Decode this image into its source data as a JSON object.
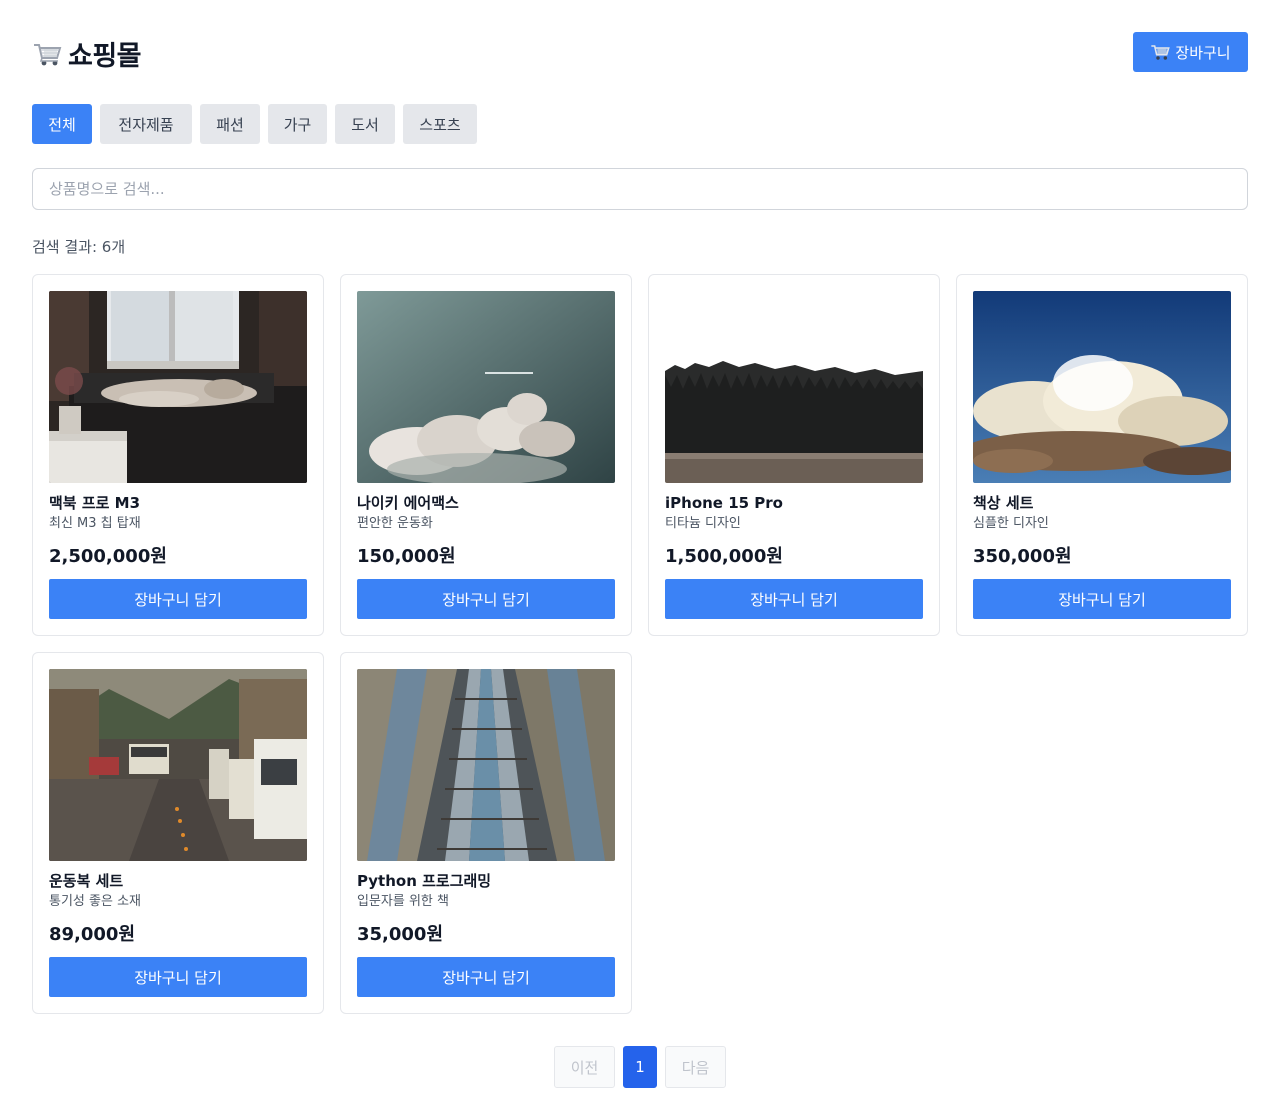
{
  "app": {
    "title": "쇼핑몰",
    "cart_button_label": "장바구니"
  },
  "categories": [
    {
      "label": "전체",
      "active": true
    },
    {
      "label": "전자제품",
      "active": false
    },
    {
      "label": "패션",
      "active": false
    },
    {
      "label": "가구",
      "active": false
    },
    {
      "label": "도서",
      "active": false
    },
    {
      "label": "스포츠",
      "active": false
    }
  ],
  "search": {
    "placeholder": "상품명으로 검색...",
    "value": ""
  },
  "results": {
    "label": "검색 결과: 6개"
  },
  "products": [
    {
      "name": "맥북 프로 M3",
      "description": "최신 M3 칩 탑재",
      "price": "2,500,000원",
      "button": "장바구니 담기",
      "image": "woman-sleeping-by-window-photo"
    },
    {
      "name": "나이키 에어맥스",
      "description": "편안한 운동화",
      "price": "150,000원",
      "button": "장바구니 담기",
      "image": "clouds-and-sky-photo"
    },
    {
      "name": "iPhone 15 Pro",
      "description": "티타늄 디자인",
      "price": "1,500,000원",
      "button": "장바구니 담기",
      "image": "forest-treeline-photo"
    },
    {
      "name": "책상 세트",
      "description": "심플한 디자인",
      "price": "350,000원",
      "button": "장바구니 담기",
      "image": "cumulus-cloud-blue-sky-photo"
    },
    {
      "name": "운동복 세트",
      "description": "통기성 좋은 소재",
      "price": "89,000원",
      "button": "장바구니 담기",
      "image": "city-street-traffic-photo"
    },
    {
      "name": "Python 프로그래밍",
      "description": "입문자를 위한 책",
      "price": "35,000원",
      "button": "장바구니 담기",
      "image": "railway-tracks-photo"
    }
  ],
  "pagination": {
    "prev": "이전",
    "current": "1",
    "next": "다음"
  },
  "colors": {
    "accent": "#3b82f6",
    "accent_dark": "#2563eb",
    "tab_inactive": "#e5e7eb"
  }
}
